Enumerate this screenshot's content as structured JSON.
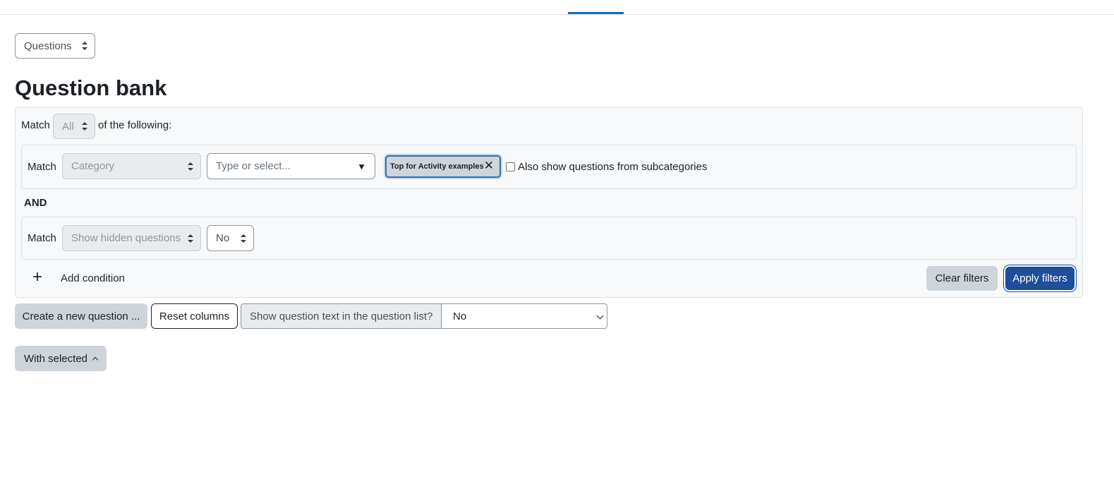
{
  "page": {
    "view_select": "Questions",
    "title": "Question bank"
  },
  "filters": {
    "match_label": "Match",
    "match_join_value": "All",
    "of_following": "of the following:",
    "conditions": [
      {
        "match_label": "Match",
        "field": "Category",
        "autocomplete_placeholder": "Type or select...",
        "autocomplete_arrow": "▼",
        "selected_chip": "Top for Activity examples",
        "chip_remove": "✕",
        "checkbox_label": "Also show questions from subcategories",
        "checkbox_checked": false
      },
      {
        "match_label": "Match",
        "field": "Show hidden questions",
        "value": "No"
      }
    ],
    "and_label": "AND",
    "add_condition_icon": "+",
    "add_condition_label": "Add condition",
    "clear_label": "Clear filters",
    "apply_label": "Apply filters"
  },
  "toolbar": {
    "create_label": "Create a new question ...",
    "reset_label": "Reset columns",
    "show_text_label": "Show question text in the question list?",
    "show_text_value": "No",
    "with_selected_label": "With selected"
  },
  "colors": {
    "primary": "#1f4e9a",
    "secondary": "#ced4da",
    "tab_active": "#0f6cbf"
  }
}
